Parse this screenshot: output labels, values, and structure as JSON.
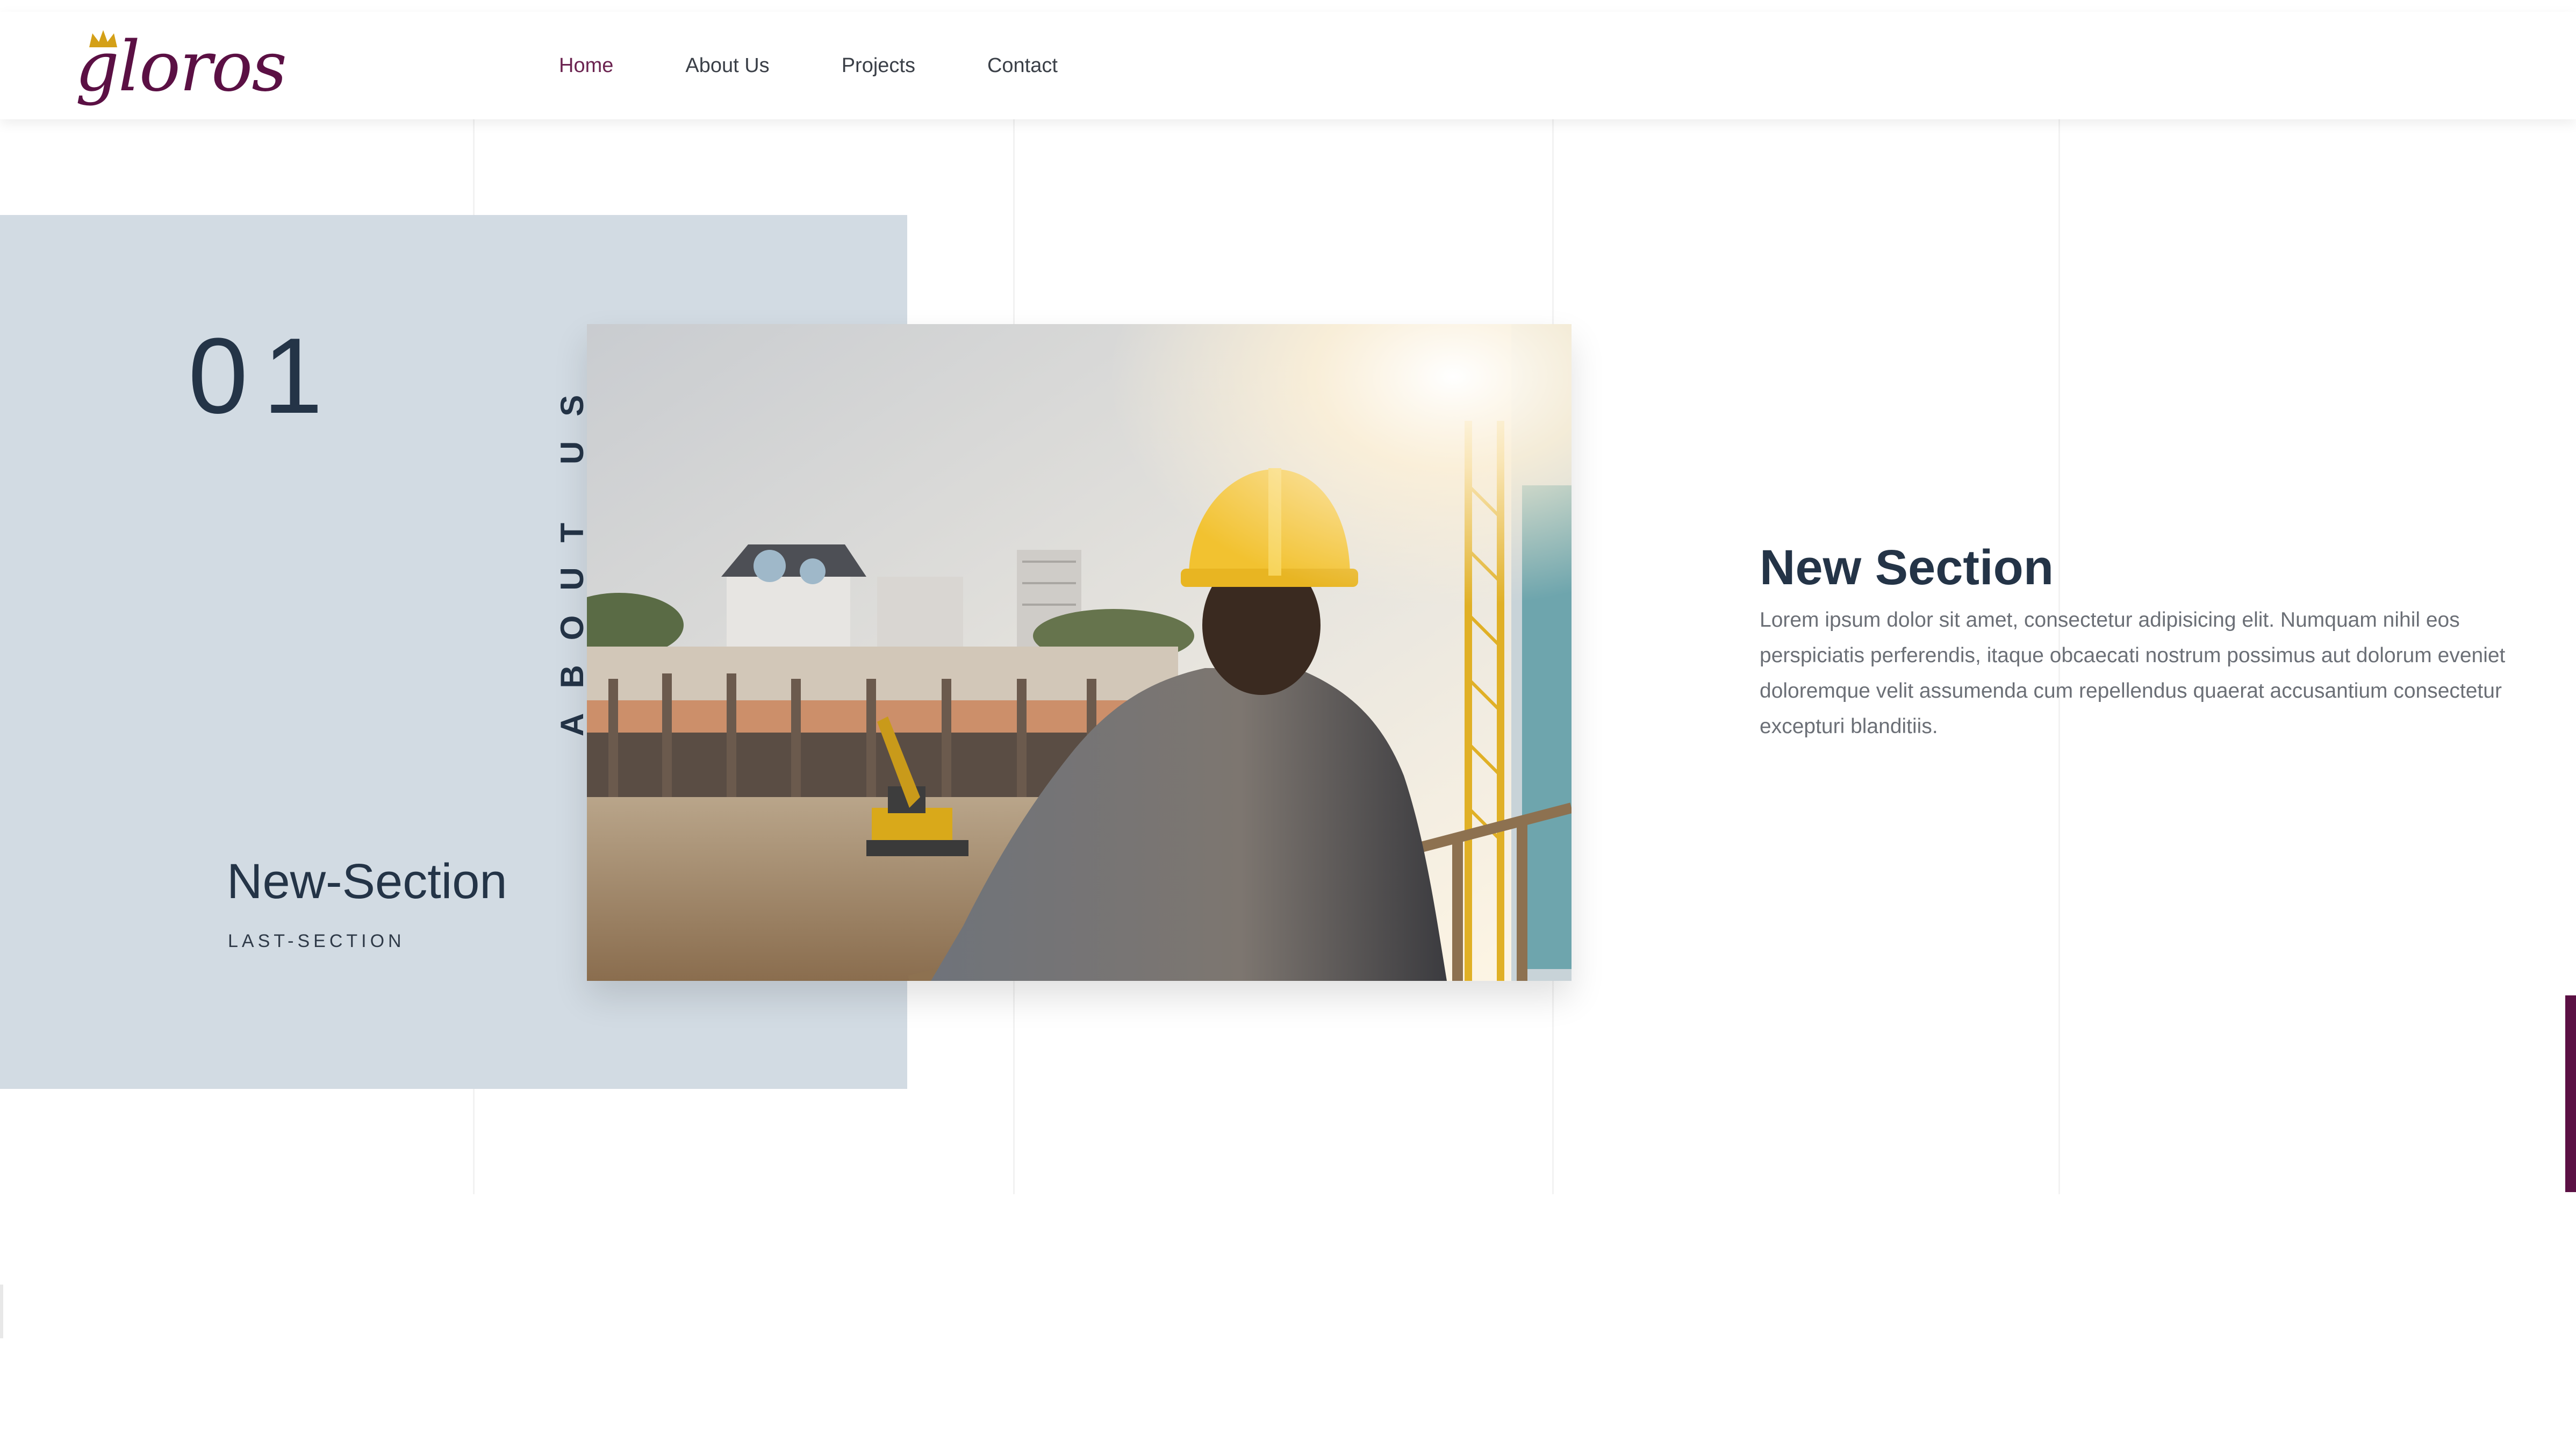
{
  "header": {
    "logo_text": "gloros",
    "nav": [
      {
        "label": "Home",
        "active": true
      },
      {
        "label": "About Us",
        "active": false
      },
      {
        "label": "Projects",
        "active": false
      },
      {
        "label": "Contact",
        "active": false
      }
    ]
  },
  "panel": {
    "number": "01",
    "vertical_label": "ABOUT US",
    "title": "New-Section",
    "subtitle": "LAST-SECTION"
  },
  "content": {
    "title": "New Section",
    "body": "Lorem ipsum dolor sit amet, consectetur adipisicing elit. Numquam nihil eos perspiciatis perferendis, itaque obcaecati nostrum possimus aut dolorum eveniet doloremque velit assumenda cum repellendus quaerat accusantium consectetur excepturi blanditiis."
  },
  "colors": {
    "brand": "#5b1044",
    "nav_active": "#6b2350",
    "panel_bg": "#d2dbe3",
    "heading": "#243447",
    "body_text": "#6b6f76"
  },
  "icons": {
    "logo_crown": "crown-icon"
  }
}
